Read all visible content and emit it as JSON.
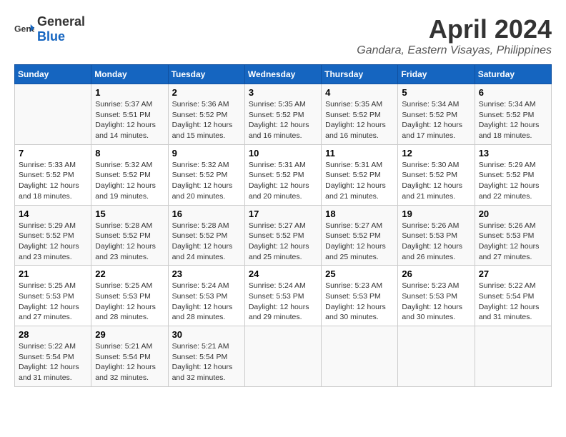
{
  "logo": {
    "text_general": "General",
    "text_blue": "Blue",
    "icon_color": "#1565C0"
  },
  "title": "April 2024",
  "location": "Gandara, Eastern Visayas, Philippines",
  "header_color": "#1565C0",
  "days_of_week": [
    "Sunday",
    "Monday",
    "Tuesday",
    "Wednesday",
    "Thursday",
    "Friday",
    "Saturday"
  ],
  "weeks": [
    [
      {
        "day": "",
        "detail": ""
      },
      {
        "day": "1",
        "detail": "Sunrise: 5:37 AM\nSunset: 5:51 PM\nDaylight: 12 hours\nand 14 minutes."
      },
      {
        "day": "2",
        "detail": "Sunrise: 5:36 AM\nSunset: 5:52 PM\nDaylight: 12 hours\nand 15 minutes."
      },
      {
        "day": "3",
        "detail": "Sunrise: 5:35 AM\nSunset: 5:52 PM\nDaylight: 12 hours\nand 16 minutes."
      },
      {
        "day": "4",
        "detail": "Sunrise: 5:35 AM\nSunset: 5:52 PM\nDaylight: 12 hours\nand 16 minutes."
      },
      {
        "day": "5",
        "detail": "Sunrise: 5:34 AM\nSunset: 5:52 PM\nDaylight: 12 hours\nand 17 minutes."
      },
      {
        "day": "6",
        "detail": "Sunrise: 5:34 AM\nSunset: 5:52 PM\nDaylight: 12 hours\nand 18 minutes."
      }
    ],
    [
      {
        "day": "7",
        "detail": "Sunrise: 5:33 AM\nSunset: 5:52 PM\nDaylight: 12 hours\nand 18 minutes."
      },
      {
        "day": "8",
        "detail": "Sunrise: 5:32 AM\nSunset: 5:52 PM\nDaylight: 12 hours\nand 19 minutes."
      },
      {
        "day": "9",
        "detail": "Sunrise: 5:32 AM\nSunset: 5:52 PM\nDaylight: 12 hours\nand 20 minutes."
      },
      {
        "day": "10",
        "detail": "Sunrise: 5:31 AM\nSunset: 5:52 PM\nDaylight: 12 hours\nand 20 minutes."
      },
      {
        "day": "11",
        "detail": "Sunrise: 5:31 AM\nSunset: 5:52 PM\nDaylight: 12 hours\nand 21 minutes."
      },
      {
        "day": "12",
        "detail": "Sunrise: 5:30 AM\nSunset: 5:52 PM\nDaylight: 12 hours\nand 21 minutes."
      },
      {
        "day": "13",
        "detail": "Sunrise: 5:29 AM\nSunset: 5:52 PM\nDaylight: 12 hours\nand 22 minutes."
      }
    ],
    [
      {
        "day": "14",
        "detail": "Sunrise: 5:29 AM\nSunset: 5:52 PM\nDaylight: 12 hours\nand 23 minutes."
      },
      {
        "day": "15",
        "detail": "Sunrise: 5:28 AM\nSunset: 5:52 PM\nDaylight: 12 hours\nand 23 minutes."
      },
      {
        "day": "16",
        "detail": "Sunrise: 5:28 AM\nSunset: 5:52 PM\nDaylight: 12 hours\nand 24 minutes."
      },
      {
        "day": "17",
        "detail": "Sunrise: 5:27 AM\nSunset: 5:52 PM\nDaylight: 12 hours\nand 25 minutes."
      },
      {
        "day": "18",
        "detail": "Sunrise: 5:27 AM\nSunset: 5:52 PM\nDaylight: 12 hours\nand 25 minutes."
      },
      {
        "day": "19",
        "detail": "Sunrise: 5:26 AM\nSunset: 5:53 PM\nDaylight: 12 hours\nand 26 minutes."
      },
      {
        "day": "20",
        "detail": "Sunrise: 5:26 AM\nSunset: 5:53 PM\nDaylight: 12 hours\nand 27 minutes."
      }
    ],
    [
      {
        "day": "21",
        "detail": "Sunrise: 5:25 AM\nSunset: 5:53 PM\nDaylight: 12 hours\nand 27 minutes."
      },
      {
        "day": "22",
        "detail": "Sunrise: 5:25 AM\nSunset: 5:53 PM\nDaylight: 12 hours\nand 28 minutes."
      },
      {
        "day": "23",
        "detail": "Sunrise: 5:24 AM\nSunset: 5:53 PM\nDaylight: 12 hours\nand 28 minutes."
      },
      {
        "day": "24",
        "detail": "Sunrise: 5:24 AM\nSunset: 5:53 PM\nDaylight: 12 hours\nand 29 minutes."
      },
      {
        "day": "25",
        "detail": "Sunrise: 5:23 AM\nSunset: 5:53 PM\nDaylight: 12 hours\nand 30 minutes."
      },
      {
        "day": "26",
        "detail": "Sunrise: 5:23 AM\nSunset: 5:53 PM\nDaylight: 12 hours\nand 30 minutes."
      },
      {
        "day": "27",
        "detail": "Sunrise: 5:22 AM\nSunset: 5:54 PM\nDaylight: 12 hours\nand 31 minutes."
      }
    ],
    [
      {
        "day": "28",
        "detail": "Sunrise: 5:22 AM\nSunset: 5:54 PM\nDaylight: 12 hours\nand 31 minutes."
      },
      {
        "day": "29",
        "detail": "Sunrise: 5:21 AM\nSunset: 5:54 PM\nDaylight: 12 hours\nand 32 minutes."
      },
      {
        "day": "30",
        "detail": "Sunrise: 5:21 AM\nSunset: 5:54 PM\nDaylight: 12 hours\nand 32 minutes."
      },
      {
        "day": "",
        "detail": ""
      },
      {
        "day": "",
        "detail": ""
      },
      {
        "day": "",
        "detail": ""
      },
      {
        "day": "",
        "detail": ""
      }
    ]
  ]
}
